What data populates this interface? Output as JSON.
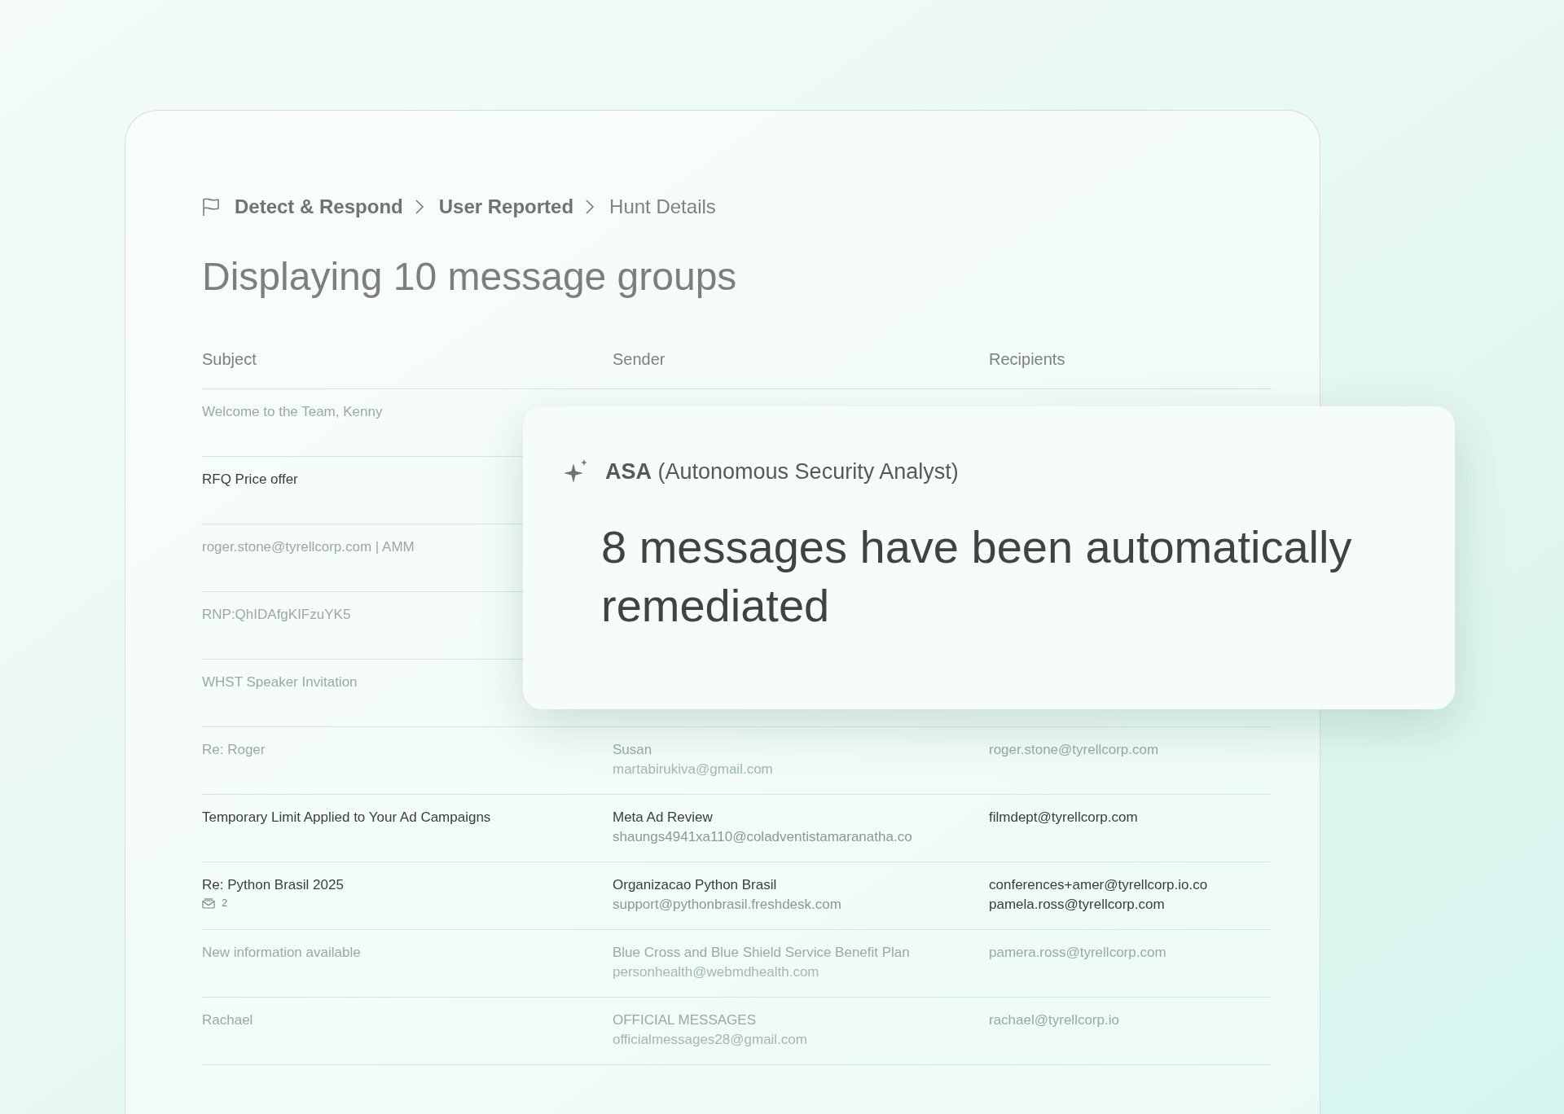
{
  "breadcrumb": [
    {
      "label": "Detect & Respond",
      "current": false
    },
    {
      "label": "User Reported",
      "current": false
    },
    {
      "label": "Hunt Details",
      "current": true
    }
  ],
  "title": "Displaying 10 message groups",
  "table": {
    "columns": [
      "Subject",
      "Sender",
      "Recipients"
    ],
    "rows": [
      {
        "subject": "Welcome to the Team, Kenny",
        "faded": true
      },
      {
        "subject": "RFQ Price offer",
        "faded": false
      },
      {
        "subject": "roger.stone@tyrellcorp.com | AMM",
        "faded": true
      },
      {
        "subject": "RNP:QhIDAfgKIFzuYK5",
        "faded": true
      },
      {
        "subject": "WHST Speaker Invitation",
        "faded": true
      },
      {
        "subject": "Re: Roger",
        "sender_name": "Susan",
        "sender_email": "martabirukiva@gmail.com",
        "recipients": [
          "roger.stone@tyrellcorp.com"
        ],
        "faded": true
      },
      {
        "subject": "Temporary Limit Applied to Your Ad Campaigns",
        "sender_name": "Meta Ad Review",
        "sender_email": "shaungs4941xa110@coladventistamaranatha.co",
        "recipients": [
          "filmdept@tyrellcorp.com"
        ],
        "faded": false
      },
      {
        "subject": "Re: Python Brasil 2025",
        "message_count": "2",
        "sender_name": "Organizacao Python Brasil",
        "sender_email": "support@pythonbrasil.freshdesk.com",
        "recipients": [
          "conferences+amer@tyrellcorp.io.co",
          "pamela.ross@tyrellcorp.com"
        ],
        "faded": false
      },
      {
        "subject": "New information available",
        "sender_name": "Blue Cross and Blue Shield Service Benefit Plan",
        "sender_email": "personhealth@webmdhealth.com",
        "recipients": [
          "pamera.ross@tyrellcorp.com"
        ],
        "faded": true
      },
      {
        "subject": "Rachael",
        "sender_name": "OFFICIAL MESSAGES",
        "sender_email": "officialmessages28@gmail.com",
        "recipients": [
          "rachael@tyrellcorp.io"
        ],
        "faded": true
      }
    ]
  },
  "popup": {
    "header": "**ASA** (Autonomous Security Analyst)",
    "message": "8 messages have been automatically remediated"
  }
}
